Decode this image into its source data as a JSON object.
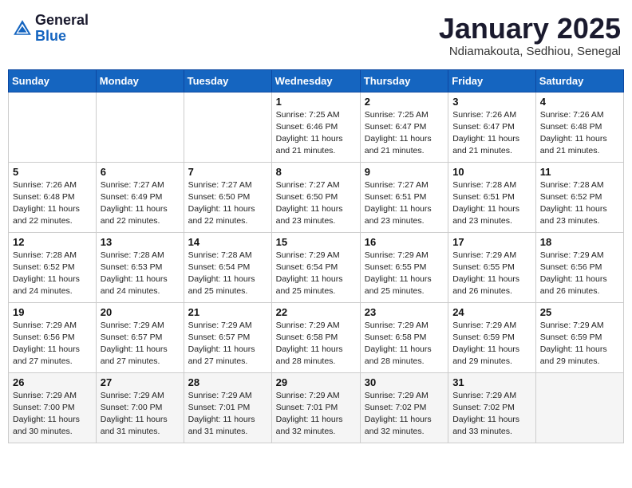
{
  "logo": {
    "general": "General",
    "blue": "Blue"
  },
  "title": "January 2025",
  "location": "Ndiamakouta, Sedhiou, Senegal",
  "days_of_week": [
    "Sunday",
    "Monday",
    "Tuesday",
    "Wednesday",
    "Thursday",
    "Friday",
    "Saturday"
  ],
  "weeks": [
    [
      {
        "day": "",
        "info": ""
      },
      {
        "day": "",
        "info": ""
      },
      {
        "day": "",
        "info": ""
      },
      {
        "day": "1",
        "info": "Sunrise: 7:25 AM\nSunset: 6:46 PM\nDaylight: 11 hours and 21 minutes."
      },
      {
        "day": "2",
        "info": "Sunrise: 7:25 AM\nSunset: 6:47 PM\nDaylight: 11 hours and 21 minutes."
      },
      {
        "day": "3",
        "info": "Sunrise: 7:26 AM\nSunset: 6:47 PM\nDaylight: 11 hours and 21 minutes."
      },
      {
        "day": "4",
        "info": "Sunrise: 7:26 AM\nSunset: 6:48 PM\nDaylight: 11 hours and 21 minutes."
      }
    ],
    [
      {
        "day": "5",
        "info": "Sunrise: 7:26 AM\nSunset: 6:48 PM\nDaylight: 11 hours and 22 minutes."
      },
      {
        "day": "6",
        "info": "Sunrise: 7:27 AM\nSunset: 6:49 PM\nDaylight: 11 hours and 22 minutes."
      },
      {
        "day": "7",
        "info": "Sunrise: 7:27 AM\nSunset: 6:50 PM\nDaylight: 11 hours and 22 minutes."
      },
      {
        "day": "8",
        "info": "Sunrise: 7:27 AM\nSunset: 6:50 PM\nDaylight: 11 hours and 23 minutes."
      },
      {
        "day": "9",
        "info": "Sunrise: 7:27 AM\nSunset: 6:51 PM\nDaylight: 11 hours and 23 minutes."
      },
      {
        "day": "10",
        "info": "Sunrise: 7:28 AM\nSunset: 6:51 PM\nDaylight: 11 hours and 23 minutes."
      },
      {
        "day": "11",
        "info": "Sunrise: 7:28 AM\nSunset: 6:52 PM\nDaylight: 11 hours and 23 minutes."
      }
    ],
    [
      {
        "day": "12",
        "info": "Sunrise: 7:28 AM\nSunset: 6:52 PM\nDaylight: 11 hours and 24 minutes."
      },
      {
        "day": "13",
        "info": "Sunrise: 7:28 AM\nSunset: 6:53 PM\nDaylight: 11 hours and 24 minutes."
      },
      {
        "day": "14",
        "info": "Sunrise: 7:28 AM\nSunset: 6:54 PM\nDaylight: 11 hours and 25 minutes."
      },
      {
        "day": "15",
        "info": "Sunrise: 7:29 AM\nSunset: 6:54 PM\nDaylight: 11 hours and 25 minutes."
      },
      {
        "day": "16",
        "info": "Sunrise: 7:29 AM\nSunset: 6:55 PM\nDaylight: 11 hours and 25 minutes."
      },
      {
        "day": "17",
        "info": "Sunrise: 7:29 AM\nSunset: 6:55 PM\nDaylight: 11 hours and 26 minutes."
      },
      {
        "day": "18",
        "info": "Sunrise: 7:29 AM\nSunset: 6:56 PM\nDaylight: 11 hours and 26 minutes."
      }
    ],
    [
      {
        "day": "19",
        "info": "Sunrise: 7:29 AM\nSunset: 6:56 PM\nDaylight: 11 hours and 27 minutes."
      },
      {
        "day": "20",
        "info": "Sunrise: 7:29 AM\nSunset: 6:57 PM\nDaylight: 11 hours and 27 minutes."
      },
      {
        "day": "21",
        "info": "Sunrise: 7:29 AM\nSunset: 6:57 PM\nDaylight: 11 hours and 27 minutes."
      },
      {
        "day": "22",
        "info": "Sunrise: 7:29 AM\nSunset: 6:58 PM\nDaylight: 11 hours and 28 minutes."
      },
      {
        "day": "23",
        "info": "Sunrise: 7:29 AM\nSunset: 6:58 PM\nDaylight: 11 hours and 28 minutes."
      },
      {
        "day": "24",
        "info": "Sunrise: 7:29 AM\nSunset: 6:59 PM\nDaylight: 11 hours and 29 minutes."
      },
      {
        "day": "25",
        "info": "Sunrise: 7:29 AM\nSunset: 6:59 PM\nDaylight: 11 hours and 29 minutes."
      }
    ],
    [
      {
        "day": "26",
        "info": "Sunrise: 7:29 AM\nSunset: 7:00 PM\nDaylight: 11 hours and 30 minutes."
      },
      {
        "day": "27",
        "info": "Sunrise: 7:29 AM\nSunset: 7:00 PM\nDaylight: 11 hours and 31 minutes."
      },
      {
        "day": "28",
        "info": "Sunrise: 7:29 AM\nSunset: 7:01 PM\nDaylight: 11 hours and 31 minutes."
      },
      {
        "day": "29",
        "info": "Sunrise: 7:29 AM\nSunset: 7:01 PM\nDaylight: 11 hours and 32 minutes."
      },
      {
        "day": "30",
        "info": "Sunrise: 7:29 AM\nSunset: 7:02 PM\nDaylight: 11 hours and 32 minutes."
      },
      {
        "day": "31",
        "info": "Sunrise: 7:29 AM\nSunset: 7:02 PM\nDaylight: 11 hours and 33 minutes."
      },
      {
        "day": "",
        "info": ""
      }
    ]
  ]
}
